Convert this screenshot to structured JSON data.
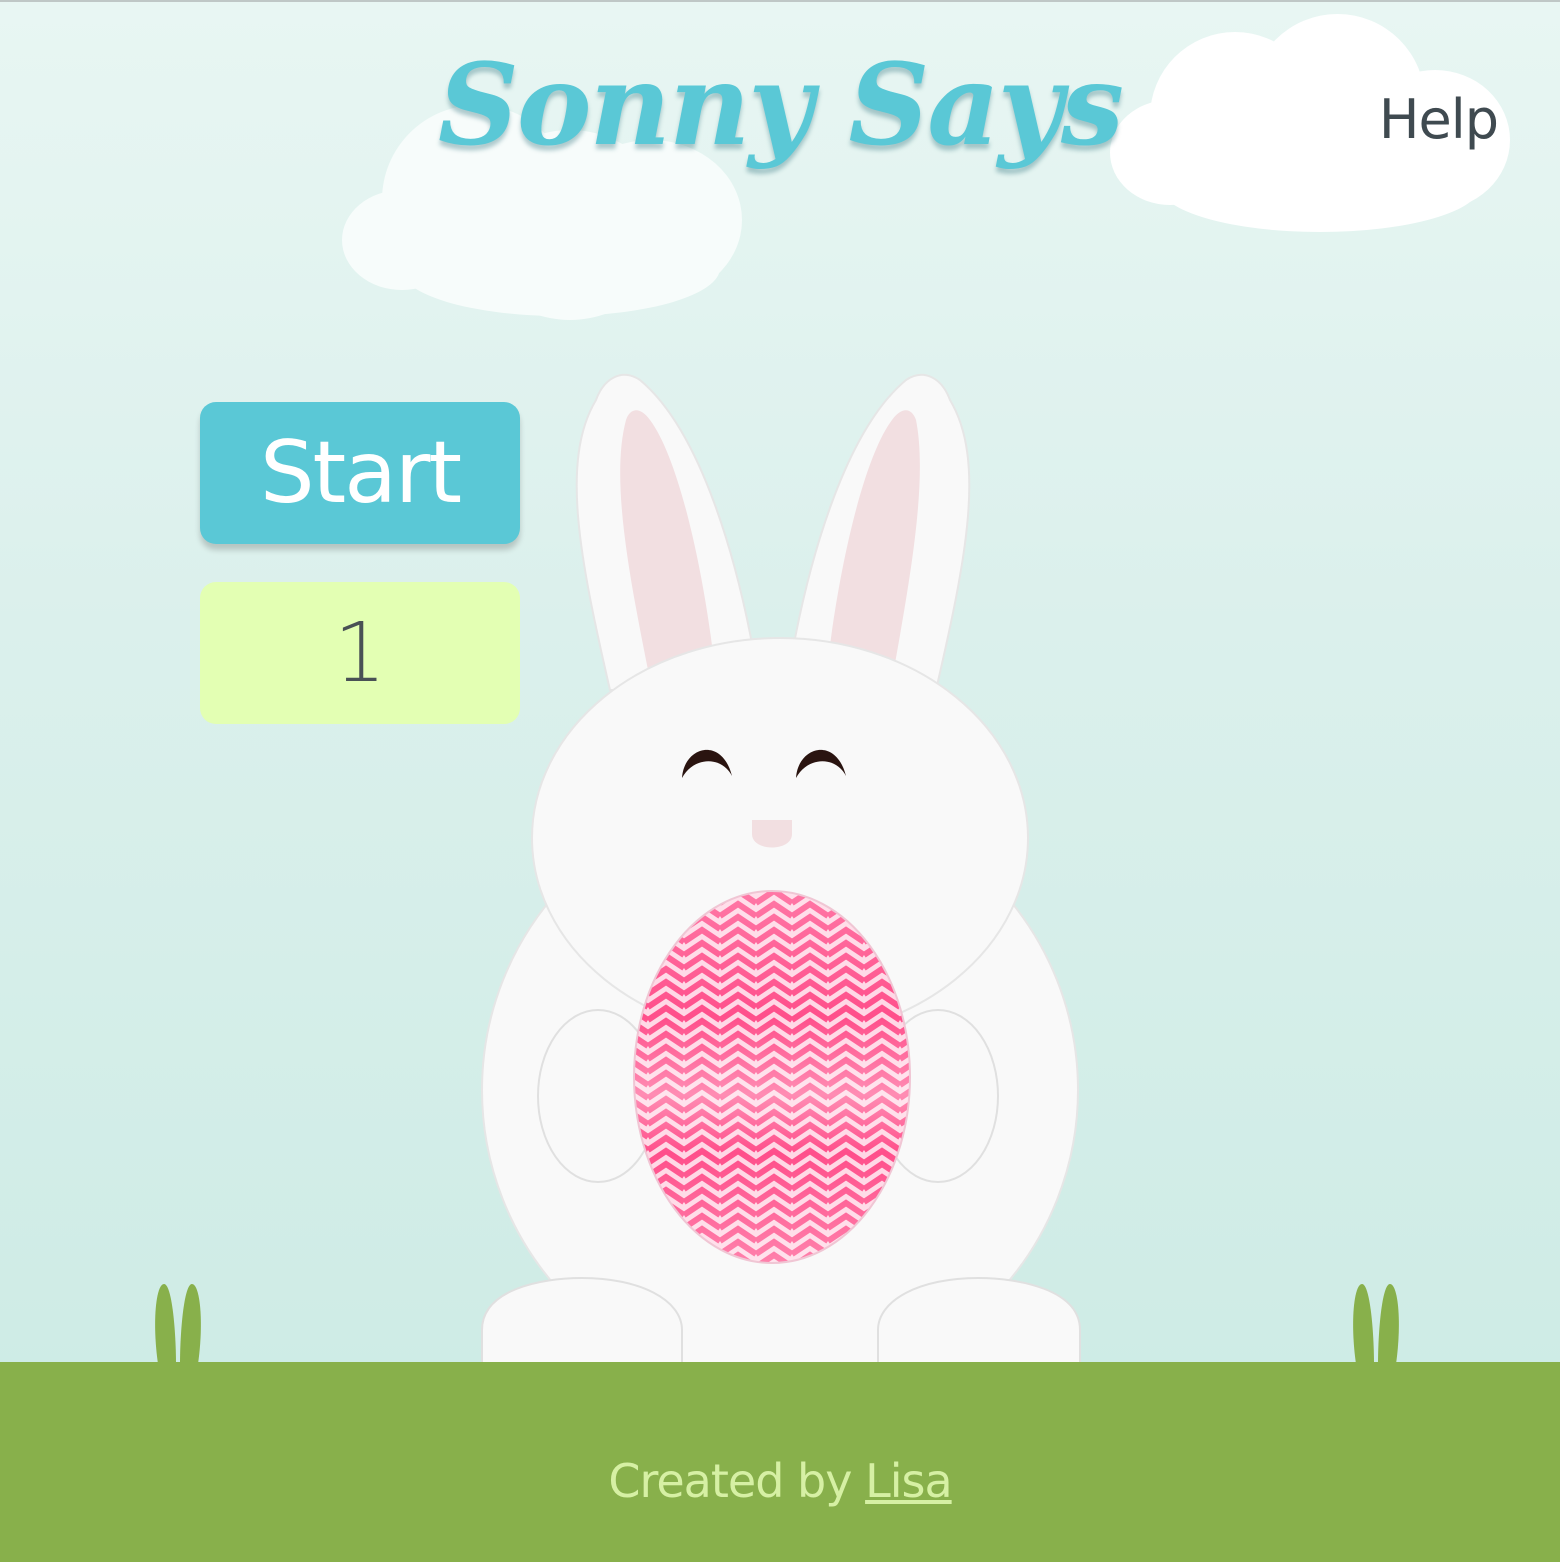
{
  "header": {
    "title": "Sonny Says",
    "help_label": "Help"
  },
  "game": {
    "start_label": "Start",
    "level": "1"
  },
  "footer": {
    "prefix": "Created by ",
    "author": "Lisa"
  },
  "colors": {
    "accent": "#5ac8d6",
    "level_bg": "#e3ffb3",
    "grass": "#88b04b",
    "egg_pink": "#ff4f8b"
  }
}
